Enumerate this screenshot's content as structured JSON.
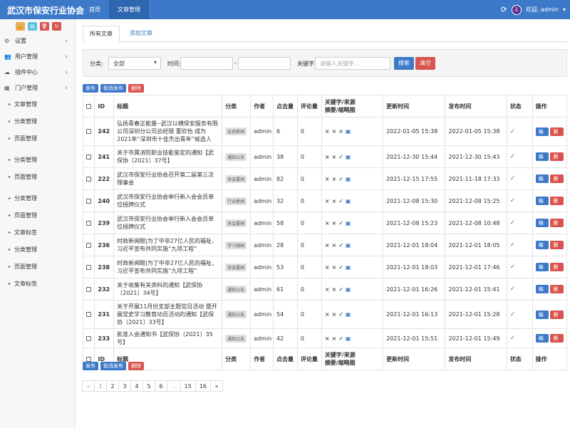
{
  "header": {
    "brand": "武汉市保安行业协会",
    "nav": [
      "首页",
      "文章管理"
    ],
    "user": "欢迎, admin"
  },
  "sidebar": {
    "menu": [
      {
        "label": "设置",
        "icon": "gear-icon"
      },
      {
        "label": "用户管理",
        "icon": "users-icon"
      },
      {
        "label": "插件中心",
        "icon": "cloud-icon"
      },
      {
        "label": "门户管理",
        "icon": "grid-icon"
      }
    ],
    "subitems": [
      "文章管理",
      "分类管理",
      "页面管理",
      "分类管理",
      "页面管理",
      "分类管理",
      "页面管理",
      "文章标签",
      "分类管理",
      "页面管理",
      "文章标签"
    ]
  },
  "tabs": [
    "所有文章",
    "添加文章"
  ],
  "filter": {
    "category_label": "分类:",
    "category_value": "全部",
    "time_label": "时间:",
    "time_sep": "-",
    "keyword_label": "关键字:",
    "keyword_placeholder": "请输入关键字...",
    "search": "搜索",
    "clear": "清空"
  },
  "bulk": {
    "publish": "发布",
    "unpublish": "取消发布",
    "delete": "删除"
  },
  "table": {
    "headers": {
      "id": "ID",
      "title": "标题",
      "category": "分类",
      "author": "作者",
      "hits": "点击量",
      "comments": "评论量",
      "flags_1": "关键字/来源",
      "flags_2": "摘要/缩略图",
      "updated": "更新时间",
      "published": "发布时间",
      "status": "状态",
      "ops": "操作"
    },
    "edit": "编辑",
    "del": "删除",
    "rows": [
      {
        "id": "242",
        "title": "弘扬青春正能量--武汉以横保安服务有限公司深圳分公司总经理 董欣怡 成为2021年“深圳市十佳杰出青年”候选人",
        "category": "会员新闻",
        "author": "admin",
        "hits": "6",
        "comments": "0",
        "flags": [
          "×",
          "×",
          "×",
          "▣"
        ],
        "updated": "2022-01-05 15:38",
        "published": "2022-01-05 15:38"
      },
      {
        "id": "241",
        "title": "关于市属消防职业技能鉴定的通知【武保协〔2021〕37号】",
        "category": "通知公告",
        "author": "admin",
        "hits": "38",
        "comments": "0",
        "flags": [
          "×",
          "×",
          "✓",
          "▣"
        ],
        "updated": "2021-12-30 15:44",
        "published": "2021-12-30 15:43"
      },
      {
        "id": "222",
        "title": "武汉市保安行业协会召开第二届第三次理事会",
        "category": "协会要闻",
        "author": "admin",
        "hits": "82",
        "comments": "0",
        "flags": [
          "×",
          "×",
          "✓",
          "▣"
        ],
        "updated": "2021-12-15 17:55",
        "published": "2021-11-18 17:33"
      },
      {
        "id": "240",
        "title": "武汉市保安行业协会举行新入会会员单位授牌仪式",
        "category": "行业新闻",
        "author": "admin",
        "hits": "32",
        "comments": "0",
        "flags": [
          "×",
          "×",
          "✓",
          "▣"
        ],
        "updated": "2021-12-08 15:30",
        "published": "2021-12-08 15:25"
      },
      {
        "id": "239",
        "title": "武汉市保安行业协会举行新入会会员单位授牌仪式",
        "category": "协会要闻",
        "author": "admin",
        "hits": "58",
        "comments": "0",
        "flags": [
          "×",
          "×",
          "✓",
          "▣"
        ],
        "updated": "2021-12-08 15:23",
        "published": "2021-12-08 10:48"
      },
      {
        "id": "236",
        "title": "时政新闻眼|为了中非27亿人民的福祉，习近平宣布共同实施“九项工程”",
        "category": "学习强国",
        "author": "admin",
        "hits": "28",
        "comments": "0",
        "flags": [
          "×",
          "×",
          "✓",
          "▣"
        ],
        "updated": "2021-12-01 18:04",
        "published": "2021-12-01 18:05"
      },
      {
        "id": "238",
        "title": "时政新闻眼|为了中非27亿人民的福祉，习近平宣布共同实施“九项工程”",
        "category": "协会要闻",
        "author": "admin",
        "hits": "53",
        "comments": "0",
        "flags": [
          "×",
          "×",
          "✓",
          "▣"
        ],
        "updated": "2021-12-01 18:03",
        "published": "2021-12-01 17:46"
      },
      {
        "id": "232",
        "title": "关于收集有关资料的通知【武保协〔2021〕34号】",
        "category": "通知公告",
        "author": "admin",
        "hits": "61",
        "comments": "0",
        "flags": [
          "×",
          "×",
          "✓",
          "▣"
        ],
        "updated": "2021-12-01 16:26",
        "published": "2021-12-01 15:41"
      },
      {
        "id": "231",
        "title": "关于开展11月份支部主题党日活动 暨开展党史学习教育动员活动的通知【武保协〔2021〕33号】",
        "category": "通知公告",
        "author": "admin",
        "hits": "54",
        "comments": "0",
        "flags": [
          "×",
          "×",
          "✓",
          "▣"
        ],
        "updated": "2021-12-01 16:13",
        "published": "2021-12-01 15:28"
      },
      {
        "id": "233",
        "title": "批准入会通知书【武保协〔2021〕35号】",
        "category": "通知公告",
        "author": "admin",
        "hits": "42",
        "comments": "0",
        "flags": [
          "×",
          "×",
          "✓",
          "▣"
        ],
        "updated": "2021-12-01 15:51",
        "published": "2021-12-01 15:49"
      }
    ]
  },
  "pagination": [
    "«",
    "1",
    "2",
    "3",
    "4",
    "5",
    "6",
    "...",
    "15",
    "16",
    "»"
  ]
}
